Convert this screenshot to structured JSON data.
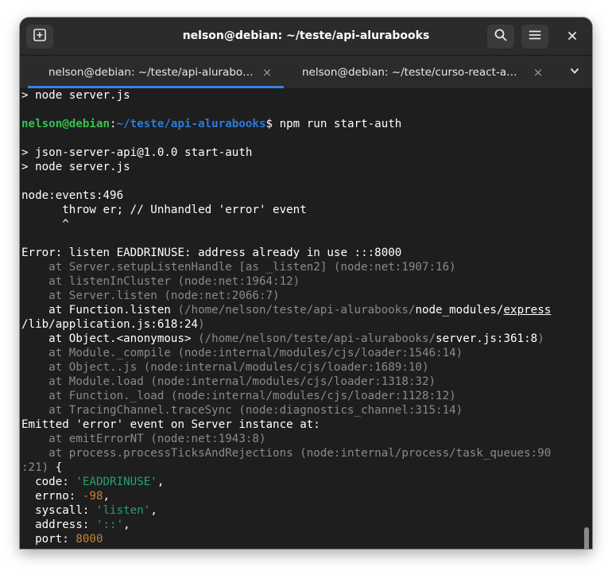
{
  "window": {
    "title": "nelson@debian: ~/teste/api-alurabooks"
  },
  "icons": {
    "new_tab": "new-tab-icon",
    "search": "search-icon",
    "menu": "hamburger-menu-icon",
    "close": "close-icon",
    "tab_close": "tab-close-icon",
    "overflow": "chevron-down-icon"
  },
  "colors": {
    "accent": "#3584e4",
    "prompt_user": "#33c24d",
    "prompt_path": "#2a7bde",
    "string": "#26a269",
    "number": "#c7813a",
    "dim": "#8a8a8a"
  },
  "tabs": [
    {
      "label": "nelson@debian: ~/teste/api-alurabooks",
      "close": "×",
      "active": true
    },
    {
      "label": "nelson@debian: ~/teste/curso-react-al…",
      "close": "×",
      "active": false
    }
  ],
  "terminal": {
    "lines": [
      {
        "segments": [
          {
            "text": "> node server.js"
          }
        ]
      },
      {
        "segments": []
      },
      {
        "segments": [
          {
            "text": "nelson@debian",
            "style": "green"
          },
          {
            "text": ":"
          },
          {
            "text": "~/teste/api-alurabooks",
            "style": "blue"
          },
          {
            "text": "$ npm run start-auth"
          }
        ]
      },
      {
        "segments": []
      },
      {
        "segments": [
          {
            "text": "> json-server-api@1.0.0 start-auth"
          }
        ]
      },
      {
        "segments": [
          {
            "text": "> node server.js"
          }
        ]
      },
      {
        "segments": []
      },
      {
        "segments": [
          {
            "text": "node:events:496"
          }
        ]
      },
      {
        "segments": [
          {
            "text": "      throw er; // Unhandled 'error' event"
          }
        ]
      },
      {
        "segments": [
          {
            "text": "      ^"
          }
        ]
      },
      {
        "segments": []
      },
      {
        "segments": [
          {
            "text": "Error: listen EADDRINUSE: address already in use :::8000"
          }
        ]
      },
      {
        "segments": [
          {
            "text": "    at Server.setupListenHandle [as _listen2] (node:net:1907:16)",
            "style": "dim"
          }
        ]
      },
      {
        "segments": [
          {
            "text": "    at listenInCluster (node:net:1964:12)",
            "style": "dim"
          }
        ]
      },
      {
        "segments": [
          {
            "text": "    at Server.listen (node:net:2066:7)",
            "style": "dim"
          }
        ]
      },
      {
        "segments": [
          {
            "text": "    at Function.listen "
          },
          {
            "text": "(/home/nelson/teste/api-alurabooks/",
            "style": "dim"
          },
          {
            "text": "node_modules/"
          },
          {
            "text": "express",
            "style": "ul"
          }
        ]
      },
      {
        "segments": [
          {
            "text": "/lib/application.js:618:24"
          },
          {
            "text": ")",
            "style": "dim"
          }
        ]
      },
      {
        "segments": [
          {
            "text": "    at Object.<anonymous> "
          },
          {
            "text": "(/home/nelson/teste/api-alurabooks/",
            "style": "dim"
          },
          {
            "text": "server.js:361:8"
          },
          {
            "text": ")",
            "style": "dim"
          }
        ]
      },
      {
        "segments": [
          {
            "text": "    at Module._compile (node:internal/modules/cjs/loader:1546:14)",
            "style": "dim"
          }
        ]
      },
      {
        "segments": [
          {
            "text": "    at Object..js (node:internal/modules/cjs/loader:1689:10)",
            "style": "dim"
          }
        ]
      },
      {
        "segments": [
          {
            "text": "    at Module.load (node:internal/modules/cjs/loader:1318:32)",
            "style": "dim"
          }
        ]
      },
      {
        "segments": [
          {
            "text": "    at Function._load (node:internal/modules/cjs/loader:1128:12)",
            "style": "dim"
          }
        ]
      },
      {
        "segments": [
          {
            "text": "    at TracingChannel.traceSync (node:diagnostics_channel:315:14)",
            "style": "dim"
          }
        ]
      },
      {
        "segments": [
          {
            "text": "Emitted 'error' event on Server instance at:"
          }
        ]
      },
      {
        "segments": [
          {
            "text": "    at emitErrorNT (node:net:1943:8)",
            "style": "dim"
          }
        ]
      },
      {
        "segments": [
          {
            "text": "    at process.processTicksAndRejections (node:internal/process/task_queues:90",
            "style": "dim"
          }
        ]
      },
      {
        "segments": [
          {
            "text": ":21)",
            "style": "dim"
          },
          {
            "text": " {"
          }
        ]
      },
      {
        "segments": [
          {
            "text": "  code: "
          },
          {
            "text": "'EADDRINUSE'",
            "style": "str"
          },
          {
            "text": ","
          }
        ]
      },
      {
        "segments": [
          {
            "text": "  errno: "
          },
          {
            "text": "-98",
            "style": "num"
          },
          {
            "text": ","
          }
        ]
      },
      {
        "segments": [
          {
            "text": "  syscall: "
          },
          {
            "text": "'listen'",
            "style": "str"
          },
          {
            "text": ","
          }
        ]
      },
      {
        "segments": [
          {
            "text": "  address: "
          },
          {
            "text": "'::'",
            "style": "str"
          },
          {
            "text": ","
          }
        ]
      },
      {
        "segments": [
          {
            "text": "  port: "
          },
          {
            "text": "8000",
            "style": "num"
          }
        ]
      }
    ]
  }
}
